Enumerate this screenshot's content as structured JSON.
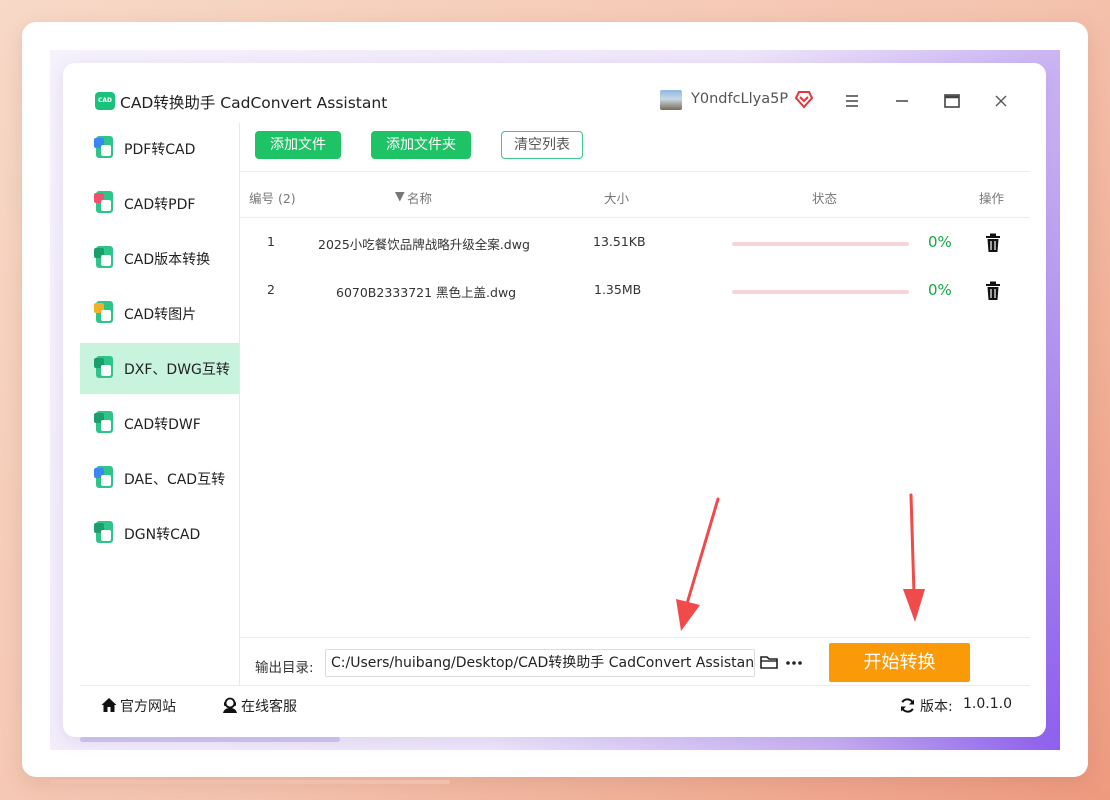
{
  "app": {
    "logo_text": "CAD",
    "title": "CAD转换助手 CadConvert Assistant",
    "user_name": "Y0ndfcLlya5P"
  },
  "window_controls": [
    "menu-icon",
    "minimize-icon",
    "maximize-icon",
    "close-icon"
  ],
  "sidebar": {
    "items": [
      {
        "label": "PDF转CAD",
        "badge_color": "#3a86f5",
        "active": false
      },
      {
        "label": "CAD转PDF",
        "badge_color": "#f0506e",
        "active": false
      },
      {
        "label": "CAD版本转换",
        "badge_color": "#2fc58a",
        "active": false
      },
      {
        "label": "CAD转图片",
        "badge_color": "#f5b026",
        "active": false
      },
      {
        "label": "DXF、DWG互转",
        "badge_color": "#2fc58a",
        "active": true
      },
      {
        "label": "CAD转DWF",
        "badge_color": "#2fc58a",
        "active": false
      },
      {
        "label": "DAE、CAD互转",
        "badge_color": "#3a86f5",
        "active": false
      },
      {
        "label": "DGN转CAD",
        "badge_color": "#2fc58a",
        "active": false
      }
    ],
    "active_color": "#c8f3dd"
  },
  "toolbar": {
    "add_file": "添加文件",
    "add_folder": "添加文件夹",
    "clear_list": "清空列表"
  },
  "table": {
    "headers": {
      "index": "编号 (2)",
      "name": "名称",
      "size": "大小",
      "status": "状态",
      "action": "操作"
    },
    "rows": [
      {
        "index": "1",
        "name": "2025小吃餐饮品牌战略升级全案.dwg",
        "size": "13.51KB",
        "progress": 0,
        "percent": "0%"
      },
      {
        "index": "2",
        "name": "6070B2333721 黑色上盖.dwg",
        "size": "1.35MB",
        "progress": 0,
        "percent": "0%"
      }
    ]
  },
  "output": {
    "label": "输出目录:",
    "path": "C:/Users/huibang/Desktop/CAD转换助手 CadConvert Assistant"
  },
  "start_button": "开始转换",
  "footer": {
    "website": "官方网站",
    "support": "在线客服",
    "version_label": "版本:",
    "version_value": "1.0.1.0"
  },
  "colors": {
    "accent_green": "#1ec365",
    "start_orange": "#fb9a08",
    "arrow_red": "#f04a4a",
    "percent_green": "#13a845"
  }
}
